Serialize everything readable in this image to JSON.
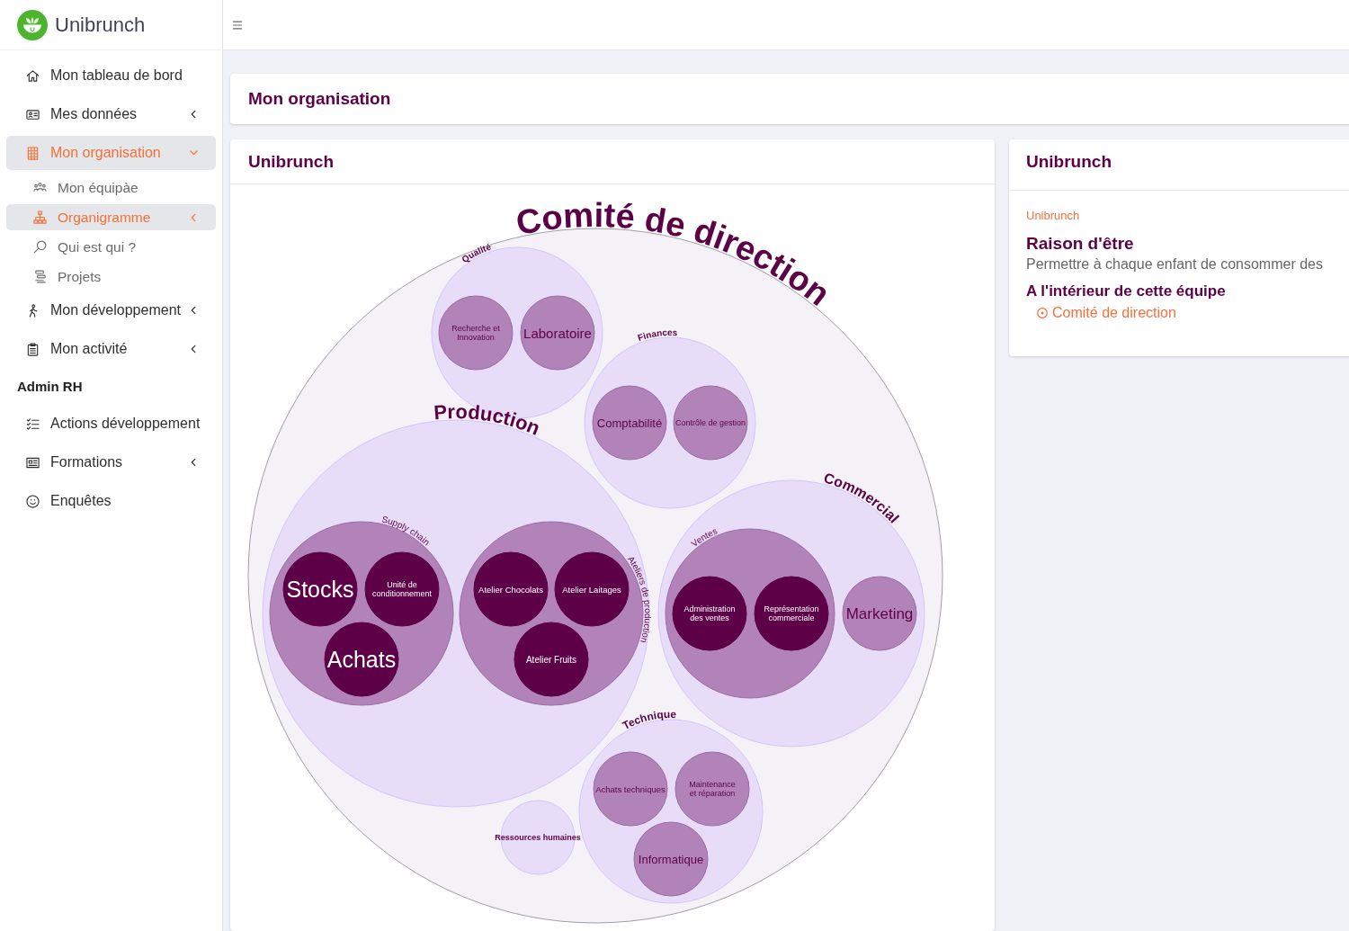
{
  "brand": {
    "name": "Unibrunch"
  },
  "sidebar": {
    "items": [
      {
        "kind": "link",
        "label": "Mon tableau de bord",
        "selected": false
      },
      {
        "kind": "link",
        "label": "Mes données",
        "selected": false,
        "expanded": false
      },
      {
        "kind": "link",
        "label": "Mon organisation",
        "selected": true,
        "expanded": true,
        "children": [
          {
            "label": "Mon équipàe",
            "selected": false
          },
          {
            "label": "Organigramme",
            "selected": true,
            "expanded": false
          },
          {
            "label": "Qui est qui ?",
            "selected": false
          },
          {
            "label": "Projets",
            "selected": false
          }
        ]
      },
      {
        "kind": "link",
        "label": "Mon développement",
        "selected": false,
        "expanded": false
      },
      {
        "kind": "link",
        "label": "Mon activité",
        "selected": false,
        "expanded": false
      },
      {
        "kind": "section",
        "label": "Admin RH"
      },
      {
        "kind": "link",
        "label": "Actions développement",
        "selected": false
      },
      {
        "kind": "link",
        "label": "Formations",
        "selected": false,
        "expanded": false
      },
      {
        "kind": "link",
        "label": "Enquêtes",
        "selected": false
      }
    ]
  },
  "page_header": {
    "title": "Mon organisation"
  },
  "chart_card": {
    "title": "Unibrunch",
    "organigram": {
      "name": "Comité de direction",
      "children": [
        {
          "name": "Qualité",
          "children": [
            {
              "name": "Recherche et Innovation"
            },
            {
              "name": "Laboratoire"
            }
          ]
        },
        {
          "name": "Finances",
          "children": [
            {
              "name": "Comptabilité"
            },
            {
              "name": "Contrôle de gestion"
            }
          ]
        },
        {
          "name": "Production",
          "children": [
            {
              "name": "Supply chain",
              "children": [
                {
                  "name": "Stocks"
                },
                {
                  "name": "Unité de conditionnement"
                },
                {
                  "name": "Achats"
                }
              ]
            },
            {
              "name": "Ateliers de production",
              "children": [
                {
                  "name": "Atelier Chocolats"
                },
                {
                  "name": "Atelier Laitages"
                },
                {
                  "name": "Atelier Fruits"
                }
              ]
            }
          ]
        },
        {
          "name": "Commercial",
          "children": [
            {
              "name": "Ventes",
              "children": [
                {
                  "name": "Administration des ventes"
                },
                {
                  "name": "Représentation commerciale"
                }
              ]
            },
            {
              "name": "Marketing"
            }
          ]
        },
        {
          "name": "Technique",
          "children": [
            {
              "name": "Achats techniques"
            },
            {
              "name": "Maintenance et réparation"
            },
            {
              "name": "Informatique"
            }
          ]
        },
        {
          "name": "Ressources humaines"
        }
      ]
    }
  },
  "detail_card": {
    "title": "Unibrunch",
    "team": "Unibrunch",
    "purpose_heading": "Raison d'être",
    "purpose": "Permettre à chaque enfant de consommer des",
    "inside_heading": "A l'intérieur de cette équipe",
    "parents": [
      {
        "label": "Comité de direction"
      }
    ]
  }
}
